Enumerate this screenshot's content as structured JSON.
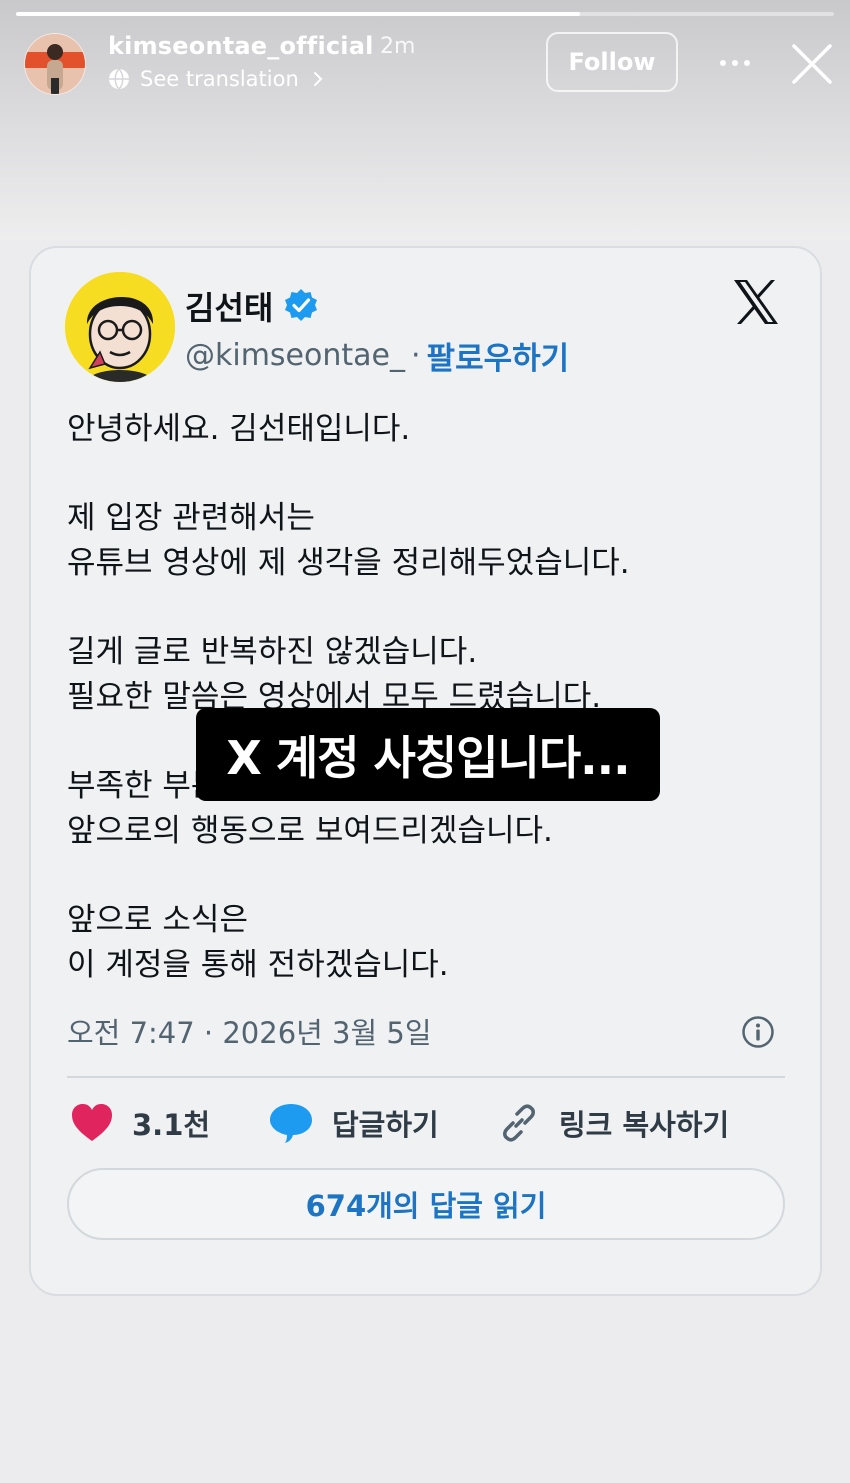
{
  "story": {
    "progress": 0.69,
    "username": "kimseontae_official",
    "time": "2m",
    "translation_label": "See translation",
    "follow_label": "Follow",
    "more_glyph": "•••",
    "icons": [
      "avatar",
      "globe-icon",
      "chevron-right-icon",
      "more-icon",
      "close-icon"
    ]
  },
  "tweet": {
    "author_name": "김선태",
    "handle": "@kimseontae_",
    "separator": "·",
    "follow_label": "팔로우하기",
    "verified": true,
    "paragraphs": [
      [
        "안녕하세요. 김선태입니다."
      ],
      [
        "제 입장 관련해서는",
        "유튜브 영상에 제 생각을 정리해두었습니다."
      ],
      [
        "길게 글로 반복하진 않겠습니다.",
        "필요한 말씀은 영상에서 모두 드렸습니다."
      ],
      [
        "부족한 부분이 있었다면",
        "앞으로의 행동으로 보여드리겠습니다."
      ],
      [
        "앞으로 소식은",
        "이 계정을 통해 전하겠습니다."
      ]
    ],
    "timestamp": "오전 7:47 · 2026년 3월 5일",
    "like_count": "3.1천",
    "reply_label": "답글하기",
    "copy_link_label": "링크 복사하기",
    "read_replies_label": "674개의 답글 읽기",
    "colors": {
      "accent_blue": "#1d74c3",
      "like_pink": "#e0245e",
      "text": "#0f1419",
      "muted": "#536471"
    }
  },
  "sticker": {
    "text": "X 계정 사칭입니다..."
  }
}
